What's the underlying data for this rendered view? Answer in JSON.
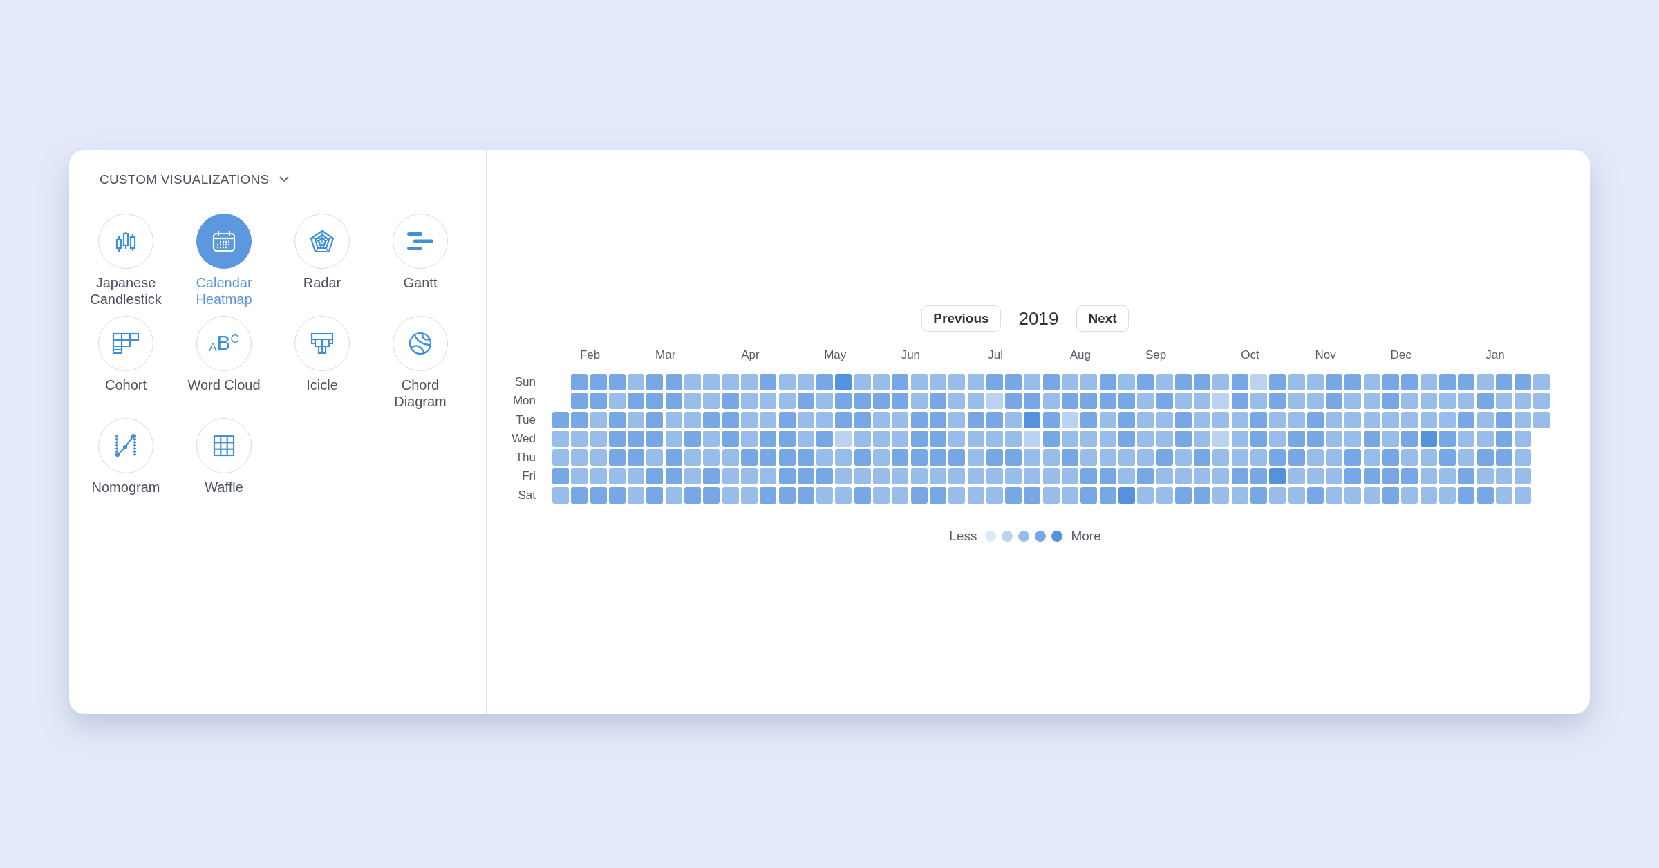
{
  "sidebar": {
    "section_title": "CUSTOM VISUALIZATIONS",
    "expanded": true,
    "items": [
      {
        "kind": "candlestick",
        "label": "Japanese Candlestick",
        "selected": false
      },
      {
        "kind": "calendar",
        "label": "Calendar Heatmap",
        "selected": true
      },
      {
        "kind": "radar",
        "label": "Radar",
        "selected": false
      },
      {
        "kind": "gantt",
        "label": "Gantt",
        "selected": false
      },
      {
        "kind": "cohort",
        "label": "Cohort",
        "selected": false
      },
      {
        "kind": "wordcloud",
        "label": "Word Cloud",
        "selected": false,
        "icon_text": "$_{A}$B$^{C}$"
      },
      {
        "kind": "icicle",
        "label": "Icicle",
        "selected": false
      },
      {
        "kind": "chord",
        "label": "Chord Diagram",
        "selected": false
      },
      {
        "kind": "nomogram",
        "label": "Nomogram",
        "selected": false
      },
      {
        "kind": "waffle",
        "label": "Waffle",
        "selected": false
      }
    ]
  },
  "heatmap": {
    "previous": "Previous",
    "year": "2019",
    "next": "Next",
    "months": [
      "Feb",
      "Mar",
      "Apr",
      "May",
      "Jun",
      "Jul",
      "Aug",
      "Sep",
      "Oct",
      "Nov",
      "Dec",
      "Jan"
    ],
    "rows": [
      {
        "day": "Sun",
        "cells": [
          null,
          {
            "color": "#77a7e4"
          },
          {
            "color": "#77a7e4"
          },
          {
            "color": "#77a7e4"
          },
          {
            "color": "#99bdeb"
          },
          {
            "color": "#77a7e4"
          },
          {
            "color": "#77a7e4"
          },
          {
            "color": "#99bdeb"
          },
          {
            "color": "#99bdeb"
          },
          {
            "color": "#99bdeb"
          },
          {
            "color": "#99bdeb"
          },
          {
            "color": "#77a7e4"
          },
          {
            "color": "#99bdeb"
          },
          {
            "color": "#99bdeb"
          },
          {
            "color": "#77a7e4"
          },
          {
            "color": "#5592de"
          },
          {
            "color": "#99bdeb"
          },
          {
            "color": "#99bdeb"
          },
          {
            "color": "#77a7e4"
          },
          {
            "color": "#99bdeb"
          },
          {
            "color": "#99bdeb"
          },
          {
            "color": "#99bdeb"
          },
          {
            "color": "#99bdeb"
          },
          {
            "color": "#77a7e4"
          },
          {
            "color": "#77a7e4"
          },
          {
            "color": "#99bdeb"
          },
          {
            "color": "#77a7e4"
          },
          {
            "color": "#99bdeb"
          },
          {
            "color": "#99bdeb"
          },
          {
            "color": "#77a7e4"
          },
          {
            "color": "#99bdeb"
          },
          {
            "color": "#77a7e4"
          },
          {
            "color": "#99bdeb"
          },
          {
            "color": "#77a7e4"
          },
          {
            "color": "#77a7e4"
          },
          {
            "color": "#99bdeb"
          },
          {
            "color": "#77a7e4"
          },
          {
            "color": "#bbd2f1"
          },
          {
            "color": "#77a7e4"
          },
          {
            "color": "#99bdeb"
          },
          {
            "color": "#99bdeb"
          },
          {
            "color": "#77a7e4"
          },
          {
            "color": "#77a7e4"
          },
          {
            "color": "#99bdeb"
          },
          {
            "color": "#77a7e4"
          },
          {
            "color": "#77a7e4"
          },
          {
            "color": "#99bdeb"
          },
          {
            "color": "#77a7e4"
          },
          {
            "color": "#77a7e4"
          },
          {
            "color": "#99bdeb"
          },
          {
            "color": "#77a7e4"
          },
          {
            "color": "#77a7e4"
          },
          {
            "color": "#99bdeb"
          }
        ]
      },
      {
        "day": "Mon",
        "cells": [
          null,
          {
            "color": "#77a7e4"
          },
          {
            "color": "#77a7e4"
          },
          {
            "color": "#99bdeb"
          },
          {
            "color": "#77a7e4"
          },
          {
            "color": "#77a7e4"
          },
          {
            "color": "#77a7e4"
          },
          {
            "color": "#99bdeb"
          },
          {
            "color": "#99bdeb"
          },
          {
            "color": "#77a7e4"
          },
          {
            "color": "#99bdeb"
          },
          {
            "color": "#99bdeb"
          },
          {
            "color": "#99bdeb"
          },
          {
            "color": "#77a7e4"
          },
          {
            "color": "#99bdeb"
          },
          {
            "color": "#77a7e4"
          },
          {
            "color": "#77a7e4"
          },
          {
            "color": "#77a7e4"
          },
          {
            "color": "#77a7e4"
          },
          {
            "color": "#99bdeb"
          },
          {
            "color": "#77a7e4"
          },
          {
            "color": "#99bdeb"
          },
          {
            "color": "#99bdeb"
          },
          {
            "color": "#bbd2f1"
          },
          {
            "color": "#77a7e4"
          },
          {
            "color": "#77a7e4"
          },
          {
            "color": "#99bdeb"
          },
          {
            "color": "#77a7e4"
          },
          {
            "color": "#77a7e4"
          },
          {
            "color": "#77a7e4"
          },
          {
            "color": "#77a7e4"
          },
          {
            "color": "#99bdeb"
          },
          {
            "color": "#77a7e4"
          },
          {
            "color": "#99bdeb"
          },
          {
            "color": "#99bdeb"
          },
          {
            "color": "#bbd2f1"
          },
          {
            "color": "#77a7e4"
          },
          {
            "color": "#99bdeb"
          },
          {
            "color": "#77a7e4"
          },
          {
            "color": "#99bdeb"
          },
          {
            "color": "#99bdeb"
          },
          {
            "color": "#77a7e4"
          },
          {
            "color": "#99bdeb"
          },
          {
            "color": "#99bdeb"
          },
          {
            "color": "#77a7e4"
          },
          {
            "color": "#99bdeb"
          },
          {
            "color": "#99bdeb"
          },
          {
            "color": "#99bdeb"
          },
          {
            "color": "#99bdeb"
          },
          {
            "color": "#77a7e4"
          },
          {
            "color": "#99bdeb"
          },
          {
            "color": "#99bdeb"
          },
          {
            "color": "#99bdeb"
          }
        ]
      },
      {
        "day": "Tue",
        "cells": [
          {
            "color": "#77a7e4"
          },
          {
            "color": "#77a7e4"
          },
          {
            "color": "#99bdeb"
          },
          {
            "color": "#77a7e4"
          },
          {
            "color": "#99bdeb"
          },
          {
            "color": "#77a7e4"
          },
          {
            "color": "#99bdeb"
          },
          {
            "color": "#99bdeb"
          },
          {
            "color": "#77a7e4"
          },
          {
            "color": "#77a7e4"
          },
          {
            "color": "#99bdeb"
          },
          {
            "color": "#99bdeb"
          },
          {
            "color": "#77a7e4"
          },
          {
            "color": "#99bdeb"
          },
          {
            "color": "#99bdeb"
          },
          {
            "color": "#77a7e4"
          },
          {
            "color": "#77a7e4"
          },
          {
            "color": "#99bdeb"
          },
          {
            "color": "#99bdeb"
          },
          {
            "color": "#77a7e4"
          },
          {
            "color": "#77a7e4"
          },
          {
            "color": "#99bdeb"
          },
          {
            "color": "#77a7e4"
          },
          {
            "color": "#77a7e4"
          },
          {
            "color": "#99bdeb"
          },
          {
            "color": "#5592de"
          },
          {
            "color": "#77a7e4"
          },
          {
            "color": "#bbd2f1"
          },
          {
            "color": "#77a7e4"
          },
          {
            "color": "#99bdeb"
          },
          {
            "color": "#77a7e4"
          },
          {
            "color": "#99bdeb"
          },
          {
            "color": "#99bdeb"
          },
          {
            "color": "#77a7e4"
          },
          {
            "color": "#99bdeb"
          },
          {
            "color": "#99bdeb"
          },
          {
            "color": "#99bdeb"
          },
          {
            "color": "#77a7e4"
          },
          {
            "color": "#99bdeb"
          },
          {
            "color": "#99bdeb"
          },
          {
            "color": "#77a7e4"
          },
          {
            "color": "#99bdeb"
          },
          {
            "color": "#99bdeb"
          },
          {
            "color": "#99bdeb"
          },
          {
            "color": "#99bdeb"
          },
          {
            "color": "#99bdeb"
          },
          {
            "color": "#99bdeb"
          },
          {
            "color": "#99bdeb"
          },
          {
            "color": "#77a7e4"
          },
          {
            "color": "#99bdeb"
          },
          {
            "color": "#77a7e4"
          },
          {
            "color": "#99bdeb"
          },
          {
            "color": "#99bdeb"
          }
        ]
      },
      {
        "day": "Wed",
        "cells": [
          {
            "color": "#99bdeb"
          },
          {
            "color": "#99bdeb"
          },
          {
            "color": "#99bdeb"
          },
          {
            "color": "#77a7e4"
          },
          {
            "color": "#77a7e4"
          },
          {
            "color": "#77a7e4"
          },
          {
            "color": "#99bdeb"
          },
          {
            "color": "#77a7e4"
          },
          {
            "color": "#99bdeb"
          },
          {
            "color": "#77a7e4"
          },
          {
            "color": "#99bdeb"
          },
          {
            "color": "#77a7e4"
          },
          {
            "color": "#77a7e4"
          },
          {
            "color": "#99bdeb"
          },
          {
            "color": "#77a7e4"
          },
          {
            "color": "#bbd2f1"
          },
          {
            "color": "#99bdeb"
          },
          {
            "color": "#99bdeb"
          },
          {
            "color": "#99bdeb"
          },
          {
            "color": "#77a7e4"
          },
          {
            "color": "#77a7e4"
          },
          {
            "color": "#99bdeb"
          },
          {
            "color": "#99bdeb"
          },
          {
            "color": "#99bdeb"
          },
          {
            "color": "#99bdeb"
          },
          {
            "color": "#bbd2f1"
          },
          {
            "color": "#77a7e4"
          },
          {
            "color": "#99bdeb"
          },
          {
            "color": "#99bdeb"
          },
          {
            "color": "#99bdeb"
          },
          {
            "color": "#77a7e4"
          },
          {
            "color": "#99bdeb"
          },
          {
            "color": "#99bdeb"
          },
          {
            "color": "#77a7e4"
          },
          {
            "color": "#99bdeb"
          },
          {
            "color": "#bbd2f1"
          },
          {
            "color": "#99bdeb"
          },
          {
            "color": "#77a7e4"
          },
          {
            "color": "#99bdeb"
          },
          {
            "color": "#77a7e4"
          },
          {
            "color": "#77a7e4"
          },
          {
            "color": "#99bdeb"
          },
          {
            "color": "#99bdeb"
          },
          {
            "color": "#77a7e4"
          },
          {
            "color": "#99bdeb"
          },
          {
            "color": "#77a7e4"
          },
          {
            "color": "#5592de"
          },
          {
            "color": "#77a7e4"
          },
          {
            "color": "#99bdeb"
          },
          {
            "color": "#99bdeb"
          },
          {
            "color": "#77a7e4"
          },
          {
            "color": "#99bdeb"
          }
        ]
      },
      {
        "day": "Thu",
        "cells": [
          {
            "color": "#99bdeb"
          },
          {
            "color": "#99bdeb"
          },
          {
            "color": "#99bdeb"
          },
          {
            "color": "#77a7e4"
          },
          {
            "color": "#77a7e4"
          },
          {
            "color": "#99bdeb"
          },
          {
            "color": "#77a7e4"
          },
          {
            "color": "#99bdeb"
          },
          {
            "color": "#99bdeb"
          },
          {
            "color": "#99bdeb"
          },
          {
            "color": "#77a7e4"
          },
          {
            "color": "#77a7e4"
          },
          {
            "color": "#77a7e4"
          },
          {
            "color": "#77a7e4"
          },
          {
            "color": "#99bdeb"
          },
          {
            "color": "#99bdeb"
          },
          {
            "color": "#77a7e4"
          },
          {
            "color": "#99bdeb"
          },
          {
            "color": "#77a7e4"
          },
          {
            "color": "#77a7e4"
          },
          {
            "color": "#77a7e4"
          },
          {
            "color": "#77a7e4"
          },
          {
            "color": "#99bdeb"
          },
          {
            "color": "#77a7e4"
          },
          {
            "color": "#77a7e4"
          },
          {
            "color": "#99bdeb"
          },
          {
            "color": "#99bdeb"
          },
          {
            "color": "#77a7e4"
          },
          {
            "color": "#99bdeb"
          },
          {
            "color": "#99bdeb"
          },
          {
            "color": "#99bdeb"
          },
          {
            "color": "#99bdeb"
          },
          {
            "color": "#77a7e4"
          },
          {
            "color": "#99bdeb"
          },
          {
            "color": "#77a7e4"
          },
          {
            "color": "#99bdeb"
          },
          {
            "color": "#99bdeb"
          },
          {
            "color": "#99bdeb"
          },
          {
            "color": "#77a7e4"
          },
          {
            "color": "#77a7e4"
          },
          {
            "color": "#99bdeb"
          },
          {
            "color": "#99bdeb"
          },
          {
            "color": "#77a7e4"
          },
          {
            "color": "#99bdeb"
          },
          {
            "color": "#77a7e4"
          },
          {
            "color": "#99bdeb"
          },
          {
            "color": "#99bdeb"
          },
          {
            "color": "#77a7e4"
          },
          {
            "color": "#99bdeb"
          },
          {
            "color": "#77a7e4"
          },
          {
            "color": "#77a7e4"
          },
          {
            "color": "#99bdeb"
          }
        ]
      },
      {
        "day": "Fri",
        "cells": [
          {
            "color": "#77a7e4"
          },
          {
            "color": "#99bdeb"
          },
          {
            "color": "#99bdeb"
          },
          {
            "color": "#99bdeb"
          },
          {
            "color": "#99bdeb"
          },
          {
            "color": "#77a7e4"
          },
          {
            "color": "#77a7e4"
          },
          {
            "color": "#99bdeb"
          },
          {
            "color": "#77a7e4"
          },
          {
            "color": "#99bdeb"
          },
          {
            "color": "#99bdeb"
          },
          {
            "color": "#99bdeb"
          },
          {
            "color": "#77a7e4"
          },
          {
            "color": "#77a7e4"
          },
          {
            "color": "#77a7e4"
          },
          {
            "color": "#99bdeb"
          },
          {
            "color": "#99bdeb"
          },
          {
            "color": "#99bdeb"
          },
          {
            "color": "#99bdeb"
          },
          {
            "color": "#99bdeb"
          },
          {
            "color": "#99bdeb"
          },
          {
            "color": "#99bdeb"
          },
          {
            "color": "#99bdeb"
          },
          {
            "color": "#99bdeb"
          },
          {
            "color": "#99bdeb"
          },
          {
            "color": "#99bdeb"
          },
          {
            "color": "#99bdeb"
          },
          {
            "color": "#99bdeb"
          },
          {
            "color": "#77a7e4"
          },
          {
            "color": "#77a7e4"
          },
          {
            "color": "#99bdeb"
          },
          {
            "color": "#77a7e4"
          },
          {
            "color": "#99bdeb"
          },
          {
            "color": "#99bdeb"
          },
          {
            "color": "#99bdeb"
          },
          {
            "color": "#99bdeb"
          },
          {
            "color": "#77a7e4"
          },
          {
            "color": "#77a7e4"
          },
          {
            "color": "#5592de"
          },
          {
            "color": "#99bdeb"
          },
          {
            "color": "#99bdeb"
          },
          {
            "color": "#99bdeb"
          },
          {
            "color": "#77a7e4"
          },
          {
            "color": "#77a7e4"
          },
          {
            "color": "#77a7e4"
          },
          {
            "color": "#77a7e4"
          },
          {
            "color": "#99bdeb"
          },
          {
            "color": "#99bdeb"
          },
          {
            "color": "#77a7e4"
          },
          {
            "color": "#99bdeb"
          },
          {
            "color": "#99bdeb"
          },
          {
            "color": "#99bdeb"
          }
        ]
      },
      {
        "day": "Sat",
        "cells": [
          {
            "color": "#99bdeb"
          },
          {
            "color": "#77a7e4"
          },
          {
            "color": "#77a7e4"
          },
          {
            "color": "#77a7e4"
          },
          {
            "color": "#99bdeb"
          },
          {
            "color": "#77a7e4"
          },
          {
            "color": "#99bdeb"
          },
          {
            "color": "#77a7e4"
          },
          {
            "color": "#77a7e4"
          },
          {
            "color": "#99bdeb"
          },
          {
            "color": "#99bdeb"
          },
          {
            "color": "#77a7e4"
          },
          {
            "color": "#77a7e4"
          },
          {
            "color": "#77a7e4"
          },
          {
            "color": "#99bdeb"
          },
          {
            "color": "#99bdeb"
          },
          {
            "color": "#77a7e4"
          },
          {
            "color": "#99bdeb"
          },
          {
            "color": "#99bdeb"
          },
          {
            "color": "#77a7e4"
          },
          {
            "color": "#77a7e4"
          },
          {
            "color": "#99bdeb"
          },
          {
            "color": "#99bdeb"
          },
          {
            "color": "#99bdeb"
          },
          {
            "color": "#77a7e4"
          },
          {
            "color": "#77a7e4"
          },
          {
            "color": "#99bdeb"
          },
          {
            "color": "#99bdeb"
          },
          {
            "color": "#77a7e4"
          },
          {
            "color": "#77a7e4"
          },
          {
            "color": "#5592de"
          },
          {
            "color": "#99bdeb"
          },
          {
            "color": "#99bdeb"
          },
          {
            "color": "#77a7e4"
          },
          {
            "color": "#77a7e4"
          },
          {
            "color": "#99bdeb"
          },
          {
            "color": "#99bdeb"
          },
          {
            "color": "#77a7e4"
          },
          {
            "color": "#99bdeb"
          },
          {
            "color": "#99bdeb"
          },
          {
            "color": "#77a7e4"
          },
          {
            "color": "#99bdeb"
          },
          {
            "color": "#99bdeb"
          },
          {
            "color": "#99bdeb"
          },
          {
            "color": "#77a7e4"
          },
          {
            "color": "#99bdeb"
          },
          {
            "color": "#99bdeb"
          },
          {
            "color": "#99bdeb"
          },
          {
            "color": "#77a7e4"
          },
          {
            "color": "#77a7e4"
          },
          {
            "color": "#99bdeb"
          },
          {
            "color": "#99bdeb"
          }
        ]
      }
    ],
    "legend": {
      "less": "Less",
      "more": "More",
      "steps": [
        {
          "color": "#dde8f8"
        },
        {
          "color": "#bbd2f1"
        },
        {
          "color": "#99bdeb"
        },
        {
          "color": "#77a7e4"
        },
        {
          "color": "#5592de"
        }
      ]
    }
  }
}
